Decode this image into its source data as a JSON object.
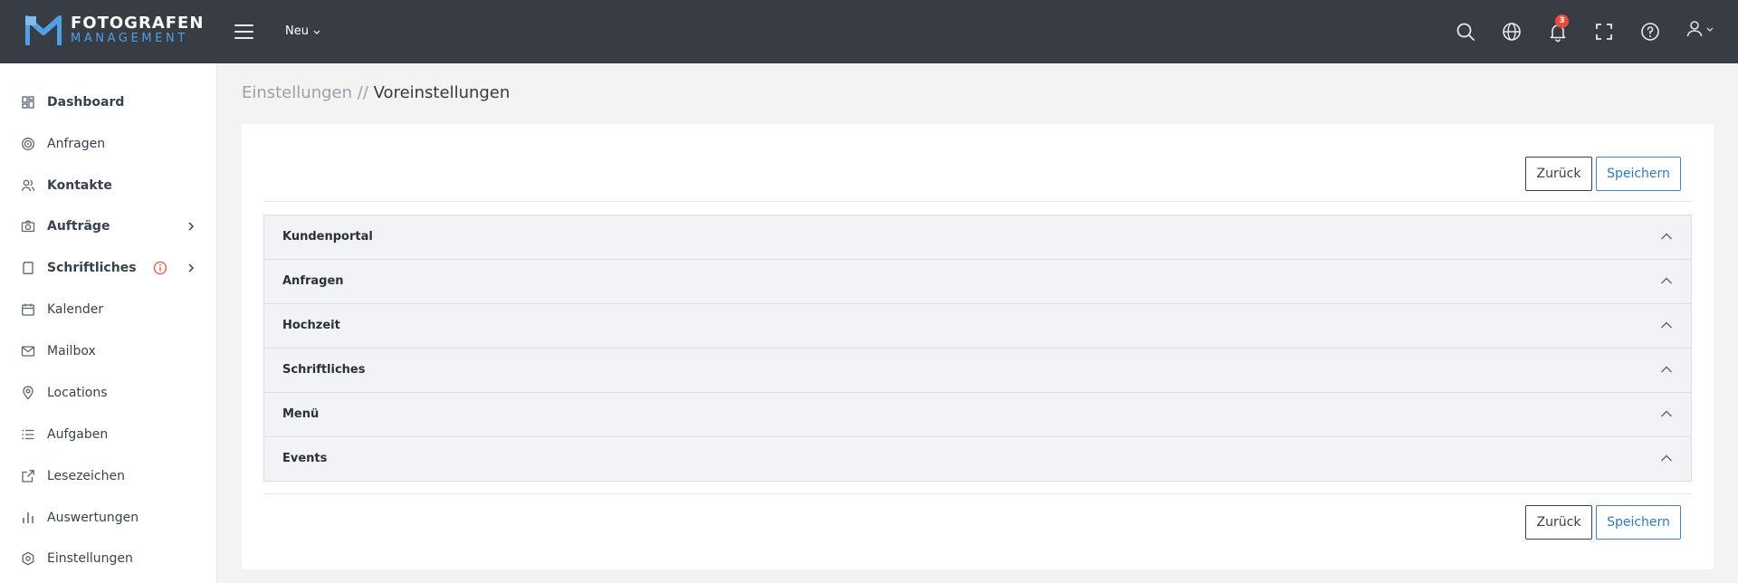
{
  "brand": {
    "name_line1": "FOTOGRAFEN",
    "name_line2": "MANAGEMENT",
    "primary_color": "#383d45",
    "accent_color": "#4f9fe6"
  },
  "topbar": {
    "new_menu_label": "Neu",
    "notification_count": "3",
    "icons": [
      "menu-icon",
      "search-icon",
      "globe-icon",
      "bell-icon",
      "fullscreen-icon",
      "help-icon",
      "user-icon"
    ]
  },
  "sidebar": {
    "items": [
      {
        "label": "Dashboard",
        "icon": "dashboard-icon"
      },
      {
        "label": "Anfragen",
        "icon": "target-icon"
      },
      {
        "label": "Kontakte",
        "icon": "users-icon"
      },
      {
        "label": "Aufträge",
        "icon": "camera-icon"
      },
      {
        "label": "Schriftliches",
        "icon": "document-icon"
      },
      {
        "label": "Kalender",
        "icon": "calendar-icon"
      },
      {
        "label": "Mailbox",
        "icon": "mail-icon"
      },
      {
        "label": "Locations",
        "icon": "location-pin-icon"
      },
      {
        "label": "Aufgaben",
        "icon": "list-icon"
      },
      {
        "label": "Lesezeichen",
        "icon": "external-link-icon"
      },
      {
        "label": "Auswertungen",
        "icon": "bar-chart-icon"
      },
      {
        "label": "Einstellungen",
        "icon": "settings-icon"
      }
    ]
  },
  "breadcrumb": {
    "parent": "Einstellungen",
    "separator": "//",
    "current": "Voreinstellungen"
  },
  "actions": {
    "back_label": "Zurück",
    "save_label": "Speichern"
  },
  "sections": [
    {
      "title": "Kundenportal"
    },
    {
      "title": "Anfragen"
    },
    {
      "title": "Hochzeit"
    },
    {
      "title": "Schriftliches"
    },
    {
      "title": "Menü"
    },
    {
      "title": "Events"
    }
  ]
}
